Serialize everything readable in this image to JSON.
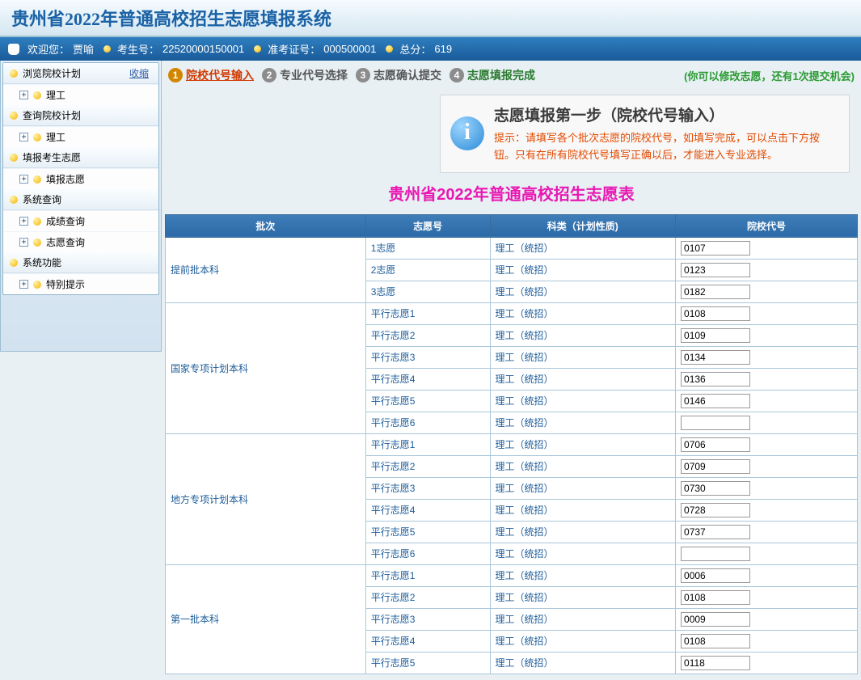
{
  "page_title": "贵州省2022年普通高校招生志愿填报系统",
  "infobar": {
    "welcome": "欢迎您：",
    "username": "贾喻",
    "exam_id_label": "考生号：",
    "exam_id": "22520000150001",
    "admit_id_label": "准考证号：",
    "admit_id": "000500001",
    "score_label": "总分：",
    "score": "619"
  },
  "sidebar": {
    "collapse": "收缩",
    "groups": [
      {
        "label": "浏览院校计划",
        "items": [
          "理工"
        ]
      },
      {
        "label": "查询院校计划",
        "items": [
          "理工"
        ]
      },
      {
        "label": "填报考生志愿",
        "items": [
          "填报志愿"
        ]
      },
      {
        "label": "系统查询",
        "items": [
          "成绩查询",
          "志愿查询"
        ]
      },
      {
        "label": "系统功能",
        "items": [
          "特别提示"
        ]
      }
    ]
  },
  "steps": {
    "items": [
      {
        "n": "1",
        "label": "院校代号输入",
        "state": "active"
      },
      {
        "n": "2",
        "label": "专业代号选择",
        "state": ""
      },
      {
        "n": "3",
        "label": "志愿确认提交",
        "state": ""
      },
      {
        "n": "4",
        "label": "志愿填报完成",
        "state": "done"
      }
    ],
    "note": "(你可以修改志愿，还有1次提交机会)"
  },
  "hint": {
    "title": "志愿填报第一步（院校代号输入）",
    "text": "提示：请填写各个批次志愿的院校代号，如填写完成，可以点击下方按钮。只有在所有院校代号填写正确以后，才能进入专业选择。"
  },
  "table": {
    "title": "贵州省2022年普通高校招生志愿表",
    "headers": [
      "批次",
      "志愿号",
      "科类（计划性质)",
      "院校代号"
    ],
    "batches": [
      {
        "name": "提前批本科",
        "rows": [
          {
            "vol": "1志愿",
            "cat": "理工（统招）",
            "code": "0107"
          },
          {
            "vol": "2志愿",
            "cat": "理工（统招）",
            "code": "0123"
          },
          {
            "vol": "3志愿",
            "cat": "理工（统招）",
            "code": "0182"
          }
        ]
      },
      {
        "name": "国家专项计划本科",
        "rows": [
          {
            "vol": "平行志愿1",
            "cat": "理工（统招）",
            "code": "0108"
          },
          {
            "vol": "平行志愿2",
            "cat": "理工（统招）",
            "code": "0109"
          },
          {
            "vol": "平行志愿3",
            "cat": "理工（统招）",
            "code": "0134"
          },
          {
            "vol": "平行志愿4",
            "cat": "理工（统招）",
            "code": "0136"
          },
          {
            "vol": "平行志愿5",
            "cat": "理工（统招）",
            "code": "0146"
          },
          {
            "vol": "平行志愿6",
            "cat": "理工（统招）",
            "code": ""
          }
        ]
      },
      {
        "name": "地方专项计划本科",
        "rows": [
          {
            "vol": "平行志愿1",
            "cat": "理工（统招）",
            "code": "0706"
          },
          {
            "vol": "平行志愿2",
            "cat": "理工（统招）",
            "code": "0709"
          },
          {
            "vol": "平行志愿3",
            "cat": "理工（统招）",
            "code": "0730"
          },
          {
            "vol": "平行志愿4",
            "cat": "理工（统招）",
            "code": "0728"
          },
          {
            "vol": "平行志愿5",
            "cat": "理工（统招）",
            "code": "0737"
          },
          {
            "vol": "平行志愿6",
            "cat": "理工（统招）",
            "code": ""
          }
        ]
      },
      {
        "name": "第一批本科",
        "rows": [
          {
            "vol": "平行志愿1",
            "cat": "理工（统招）",
            "code": "0006"
          },
          {
            "vol": "平行志愿2",
            "cat": "理工（统招）",
            "code": "0108"
          },
          {
            "vol": "平行志愿3",
            "cat": "理工（统招）",
            "code": "0009"
          },
          {
            "vol": "平行志愿4",
            "cat": "理工（统招）",
            "code": "0108"
          },
          {
            "vol": "平行志愿5",
            "cat": "理工（统招）",
            "code": "0118"
          }
        ]
      }
    ]
  }
}
